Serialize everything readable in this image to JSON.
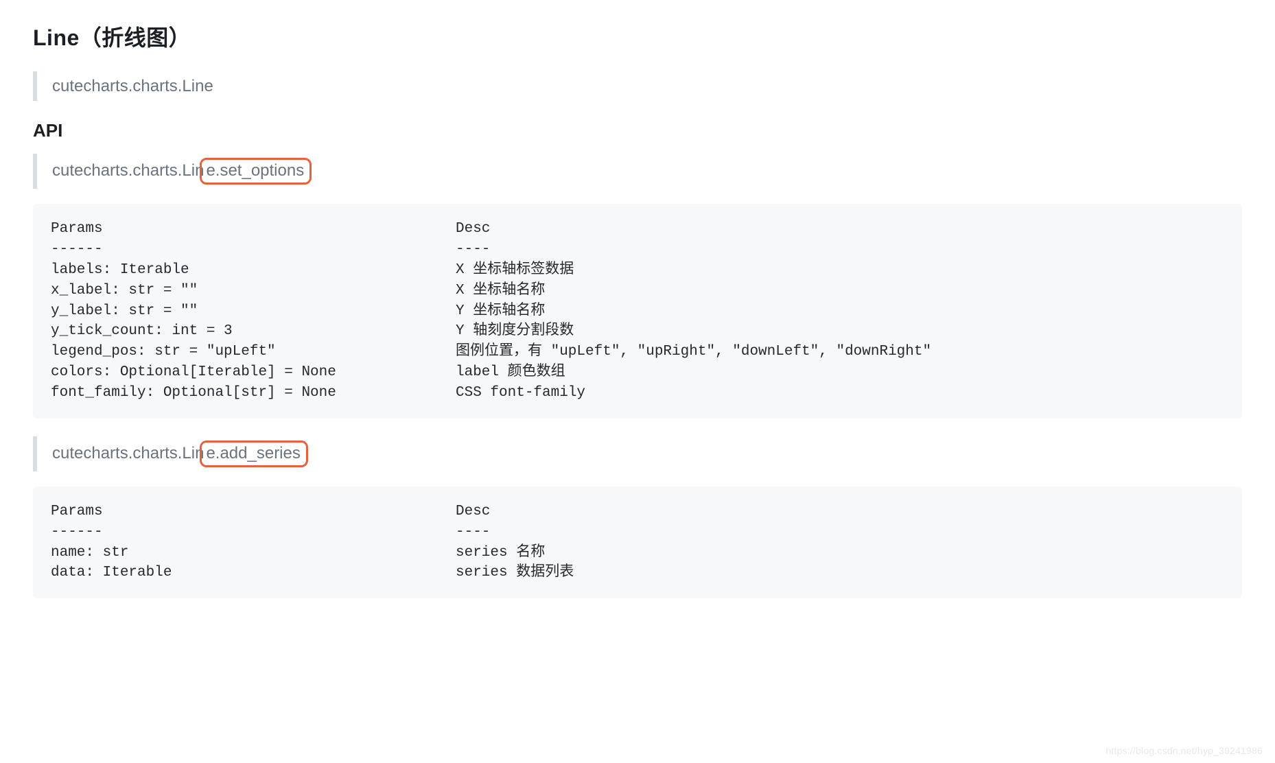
{
  "heading": "Line（折线图）",
  "quote1": "cutecharts.charts.Line",
  "api_heading": "API",
  "quote2_prefix": "cutecharts.charts.Lin",
  "quote2_highlight": "e.set_options",
  "set_options": {
    "params_header": "Params",
    "params_rule": "------",
    "desc_header": "Desc",
    "desc_rule": "----",
    "rows": [
      {
        "param": "labels: Iterable",
        "desc": "X 坐标轴标签数据"
      },
      {
        "param": "x_label: str = \"\"",
        "desc": "X 坐标轴名称"
      },
      {
        "param": "y_label: str = \"\"",
        "desc": "Y 坐标轴名称"
      },
      {
        "param": "y_tick_count: int = 3",
        "desc": "Y 轴刻度分割段数"
      },
      {
        "param": "legend_pos: str = \"upLeft\"",
        "desc": "图例位置，有 \"upLeft\", \"upRight\", \"downLeft\", \"downRight\""
      },
      {
        "param": "colors: Optional[Iterable] = None",
        "desc": "label 颜色数组"
      },
      {
        "param": "font_family: Optional[str] = None",
        "desc": "CSS font-family"
      }
    ]
  },
  "quote3_prefix": "cutecharts.charts.Lin",
  "quote3_highlight": "e.add_series",
  "add_series": {
    "params_header": "Params",
    "params_rule": "------",
    "desc_header": "Desc",
    "desc_rule": "----",
    "rows": [
      {
        "param": "name: str",
        "desc": "series 名称"
      },
      {
        "param": "data: Iterable",
        "desc": "series 数据列表"
      }
    ]
  },
  "watermark": "https://blog.csdn.net/hyp_39241986"
}
